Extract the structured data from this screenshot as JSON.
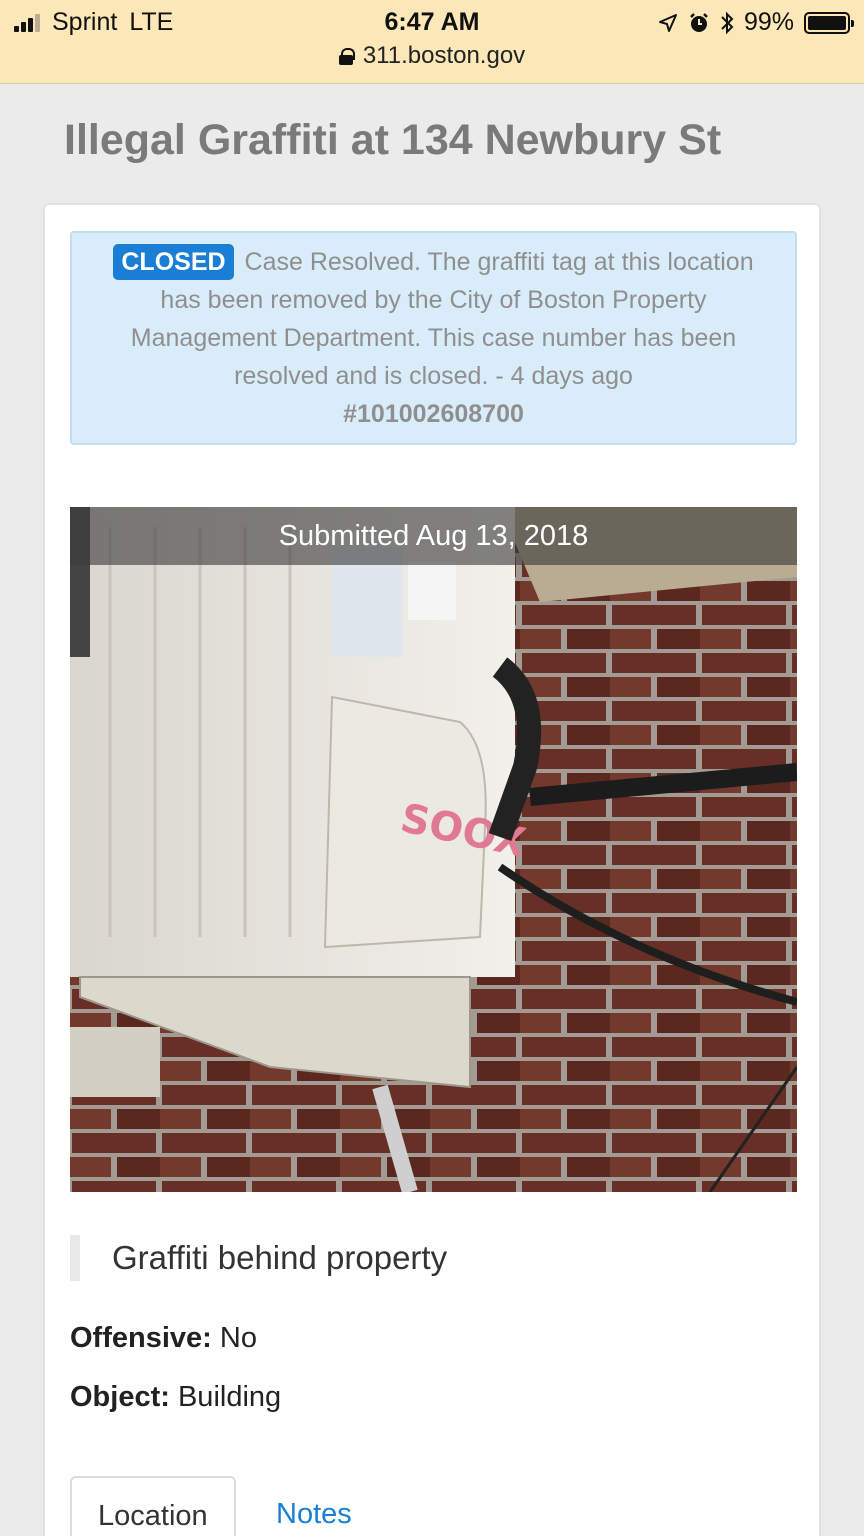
{
  "status_bar": {
    "carrier": "Sprint",
    "network": "LTE",
    "time": "6:47 AM",
    "battery": "99%",
    "url": "311.boston.gov",
    "icons": [
      "signal-icon",
      "location-arrow-icon",
      "alarm-icon",
      "bluetooth-icon",
      "battery-icon",
      "lock-icon"
    ]
  },
  "page": {
    "title": "Illegal Graffiti at 134 Newbury St"
  },
  "status_alert": {
    "badge": "CLOSED",
    "message": "Case Resolved. The graffiti tag at this location has been removed by the City of Boston Property Management Department. This case number has been resolved and is closed. - 4 days ago",
    "case_number": "#101002608700",
    "colors": {
      "badge": "#1a7fd4",
      "background": "#d9ecf9"
    }
  },
  "photo": {
    "caption": "Submitted Aug 13, 2018",
    "graffiti_text": "SOOX"
  },
  "description": "Graffiti behind property",
  "fields": [
    {
      "label": "Offensive:",
      "value": "No"
    },
    {
      "label": "Object:",
      "value": "Building"
    }
  ],
  "tabs": [
    {
      "label": "Location",
      "active": true
    },
    {
      "label": "Notes",
      "active": false
    }
  ]
}
